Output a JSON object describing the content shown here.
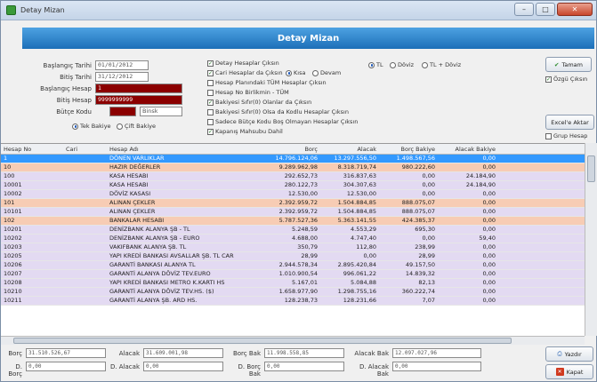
{
  "window": {
    "title": "Detay Mizan"
  },
  "banner": "Detay Mizan",
  "filters": {
    "baslangic_tarihi_label": "Başlangıç Tarihi",
    "baslangic_tarihi": "01/01/2012",
    "bitis_tarihi_label": "Bitiş Tarihi",
    "bitis_tarihi": "31/12/2012",
    "baslangic_hesap_label": "Başlangıç Hesap",
    "baslangic_hesap": "1",
    "bitis_hesap_label": "Bitiş Hesap",
    "bitis_hesap": "9999999999",
    "butce_kodu_label": "Bütçe Kodu",
    "butce_kodu": "",
    "butce_suffix": "Binsk",
    "tek_bakiye": "Tek Bakiye",
    "cift_bakiye": "Çift Bakiye"
  },
  "options": [
    {
      "label": "Detay Hesaplar Çıksın",
      "checked": true
    },
    {
      "label": "Cari Hesaplar da Çıksın",
      "checked": true
    },
    {
      "label": "Hesap Planındaki TÜM Hesaplar Çıksın",
      "checked": false
    },
    {
      "label": "Hesap No Birlikmin - TÜM",
      "checked": false
    },
    {
      "label": "Bakiyesi Sıfır(0) Olanlar da Çıksın",
      "checked": true
    },
    {
      "label": "Bakiyesi Sıfır(0) Olsa da Kodlu Hesaplar Çıksın",
      "checked": false
    },
    {
      "label": "Sadece Bütçe Kodu Boş Olmayan Hesaplar Çıksın",
      "checked": false
    },
    {
      "label": "Kapanış Mahsubu Dahil",
      "checked": true
    }
  ],
  "kisa_radio": {
    "kisa": "Kısa",
    "devam": "Devam"
  },
  "currency": {
    "tl": "TL",
    "doviz": "Döviz",
    "tl_doviz": "TL + Döviz"
  },
  "buttons": {
    "tamam": "Tamam",
    "ozgu_ciksin": "Özgü Çıksın",
    "excel": "Excel'e Aktar",
    "grup_hesap": "Grup Hesap",
    "yazdir": "Yazdır",
    "kapat": "Kapat"
  },
  "table": {
    "headers": [
      "Hesap No",
      "Cari",
      "Hesap Adı",
      "Borç",
      "Alacak",
      "Borç Bakiye",
      "Alacak Bakiye"
    ],
    "rows": [
      {
        "no": "1",
        "cari": "",
        "ad": "DÖNEN VARLIKLAR",
        "borc": "14.796.124,06",
        "alacak": "13.297.556,50",
        "bb": "1.498.567,56",
        "ab": "0,00",
        "style": "sel"
      },
      {
        "no": "10",
        "cari": "",
        "ad": "HAZIR DEĞERLER",
        "borc": "9.289.962,98",
        "alacak": "8.318.719,74",
        "bb": "980.222,60",
        "ab": "0,00",
        "style": "peach"
      },
      {
        "no": "100",
        "cari": "",
        "ad": "KASA HESABI",
        "borc": "292.652,73",
        "alacak": "316.837,63",
        "bb": "0,00",
        "ab": "24.184,90",
        "style": "lilac"
      },
      {
        "no": "10001",
        "cari": "",
        "ad": "KASA HESABI",
        "borc": "280.122,73",
        "alacak": "304.307,63",
        "bb": "0,00",
        "ab": "24.184,90",
        "style": "lilac"
      },
      {
        "no": "10002",
        "cari": "",
        "ad": "DÖVİZ KASASI",
        "borc": "12.530,00",
        "alacak": "12.530,00",
        "bb": "0,00",
        "ab": "0,00",
        "style": "lilac"
      },
      {
        "no": "101",
        "cari": "",
        "ad": "ALINAN ÇEKLER",
        "borc": "2.392.959,72",
        "alacak": "1.504.884,85",
        "bb": "888.075,07",
        "ab": "0,00",
        "style": "peach"
      },
      {
        "no": "10101",
        "cari": "",
        "ad": "ALINAN ÇEKLER",
        "borc": "2.392.959,72",
        "alacak": "1.504.884,85",
        "bb": "888.075,07",
        "ab": "0,00",
        "style": "lilac"
      },
      {
        "no": "102",
        "cari": "",
        "ad": "BANKALAR HESABI",
        "borc": "5.787.527,36",
        "alacak": "5.363.141,55",
        "bb": "424.385,37",
        "ab": "0,00",
        "style": "peach"
      },
      {
        "no": "10201",
        "cari": "",
        "ad": "DENİZBANK ALANYA ŞB - TL",
        "borc": "5.248,59",
        "alacak": "4.553,29",
        "bb": "695,30",
        "ab": "0,00",
        "style": "lilac"
      },
      {
        "no": "10202",
        "cari": "",
        "ad": "DENİZBANK ALANYA ŞB - EURO",
        "borc": "4.688,00",
        "alacak": "4.747,40",
        "bb": "0,00",
        "ab": "59,40",
        "style": "lilac"
      },
      {
        "no": "10203",
        "cari": "",
        "ad": "VAKIFBANK ALANYA ŞB. TL",
        "borc": "350,79",
        "alacak": "112,80",
        "bb": "238,99",
        "ab": "0,00",
        "style": "lilac"
      },
      {
        "no": "10205",
        "cari": "",
        "ad": "YAPI KREDİ BANKASI AVSALLAR ŞB. TL CAR",
        "borc": "28,99",
        "alacak": "0,00",
        "bb": "28,99",
        "ab": "0,00",
        "style": "lilac"
      },
      {
        "no": "10206",
        "cari": "",
        "ad": "GARANTİ BANKASI ALANYA TL",
        "borc": "2.944.578,34",
        "alacak": "2.895.420,84",
        "bb": "49.157,50",
        "ab": "0,00",
        "style": "lilac"
      },
      {
        "no": "10207",
        "cari": "",
        "ad": "GARANTİ ALANYA DÖVİZ TEV.EURO",
        "borc": "1.010.900,54",
        "alacak": "996.061,22",
        "bb": "14.839,32",
        "ab": "0,00",
        "style": "lilac"
      },
      {
        "no": "10208",
        "cari": "",
        "ad": "YAPI KREDİ BANKASI METRO K.KARTI HS",
        "borc": "5.167,01",
        "alacak": "5.084,88",
        "bb": "82,13",
        "ab": "0,00",
        "style": "lilac"
      },
      {
        "no": "10210",
        "cari": "",
        "ad": "GARANTİ ALANYA DÖVİZ TEV.HS. ($)",
        "borc": "1.658.977,90",
        "alacak": "1.298.755,16",
        "bb": "360.222,74",
        "ab": "0,00",
        "style": "lilac"
      },
      {
        "no": "10211",
        "cari": "",
        "ad": "GARANTİ ALANYA ŞB. ARD HS.",
        "borc": "128.238,73",
        "alacak": "128.231,66",
        "bb": "7,07",
        "ab": "0,00",
        "style": "lilac"
      }
    ]
  },
  "totals": {
    "borc_label": "Borç",
    "borc": "31.510.526,67",
    "alacak_label": "Alacak",
    "alacak": "31.609.001,98",
    "borc_bak_label": "Borç Bak",
    "borc_bak": "11.998.558,85",
    "alacak_bak_label": "Alacak Bak",
    "alacak_bak": "12.097.027,96",
    "d_borc_label": "D. Borç",
    "d_borc": "0,00",
    "d_alacak_label": "D. Alacak",
    "d_alacak": "0,00",
    "d_borc_bak_label": "D. Borç Bak",
    "d_borc_bak": "0,00",
    "d_alacak_bak_label": "D. Alacak Bak",
    "d_alacak_bak": "0,00"
  },
  "colors": {
    "sel": "#3399ff",
    "peach": "#f7ccb4",
    "lilac": "#e3daf2",
    "title_banner": "#2e86d4"
  }
}
